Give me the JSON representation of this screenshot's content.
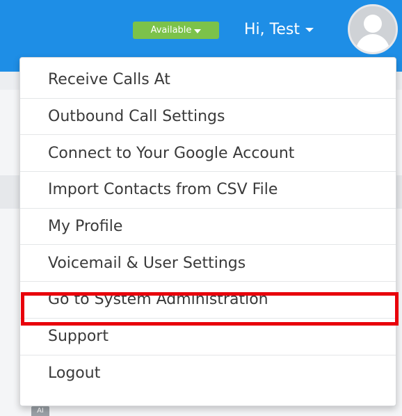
{
  "header": {
    "status_label": "Available",
    "greeting": "Hi, Test"
  },
  "avatar_icon": "user-silhouette-icon",
  "menu": {
    "items": [
      {
        "label": "Receive Calls At"
      },
      {
        "label": "Outbound Call Settings"
      },
      {
        "label": "Connect to Your Google Account"
      },
      {
        "label": "Import Contacts from CSV File"
      },
      {
        "label": "My Profile"
      },
      {
        "label": "Voicemail & User Settings"
      },
      {
        "label": "Go to System Administration"
      },
      {
        "label": "Support"
      },
      {
        "label": "Logout"
      }
    ],
    "highlighted_item": "Go to System Administration"
  },
  "colors": {
    "topbar": "#1e8ee6",
    "status_badge": "#7cc24a",
    "highlight": "#e8000b"
  }
}
